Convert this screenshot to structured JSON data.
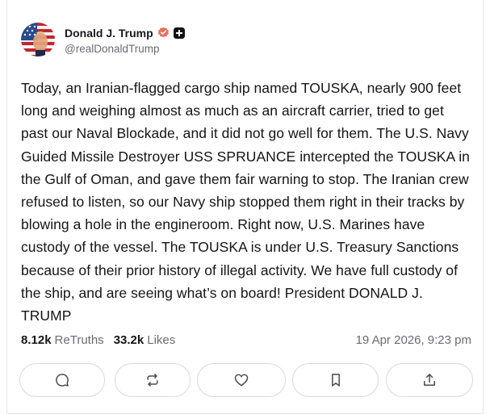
{
  "author": {
    "display_name": "Donald J. Trump",
    "handle": "@realDonaldTrump"
  },
  "post": {
    "text": "Today, an Iranian-flagged cargo ship named TOUSKA, nearly 900 feet long and weighing almost as much as an aircraft carrier, tried to get past our Naval Blockade, and it did not go well for them. The U.S. Navy Guided Missile Destroyer USS SPRUANCE intercepted the TOUSKA in the Gulf of Oman, and gave them fair warning to stop. The Iranian crew refused to listen, so our Navy ship stopped them right in their tracks by blowing a hole in the engineroom. Right now, U.S. Marines have custody of the vessel. The TOUSKA is under U.S. Treasury Sanctions because of their prior history of illegal activity. We have full custody of the ship, and are seeing what’s on board! President DONALD J. TRUMP"
  },
  "stats": {
    "retruths_count": "8.12k",
    "retruths_label": "ReTruths",
    "likes_count": "33.2k",
    "likes_label": "Likes",
    "timestamp": "19 Apr 2026, 9:23 pm"
  },
  "actions": [
    {
      "name": "reply",
      "icon": "reply-icon"
    },
    {
      "name": "retruth",
      "icon": "retruth-icon"
    },
    {
      "name": "like",
      "icon": "heart-icon"
    },
    {
      "name": "bookmark",
      "icon": "bookmark-icon"
    },
    {
      "name": "share",
      "icon": "share-icon"
    }
  ],
  "colors": {
    "verified_badge": "#e8705a",
    "text_primary": "#15151a",
    "text_secondary": "#6b6b75",
    "border": "#d9d9de"
  }
}
